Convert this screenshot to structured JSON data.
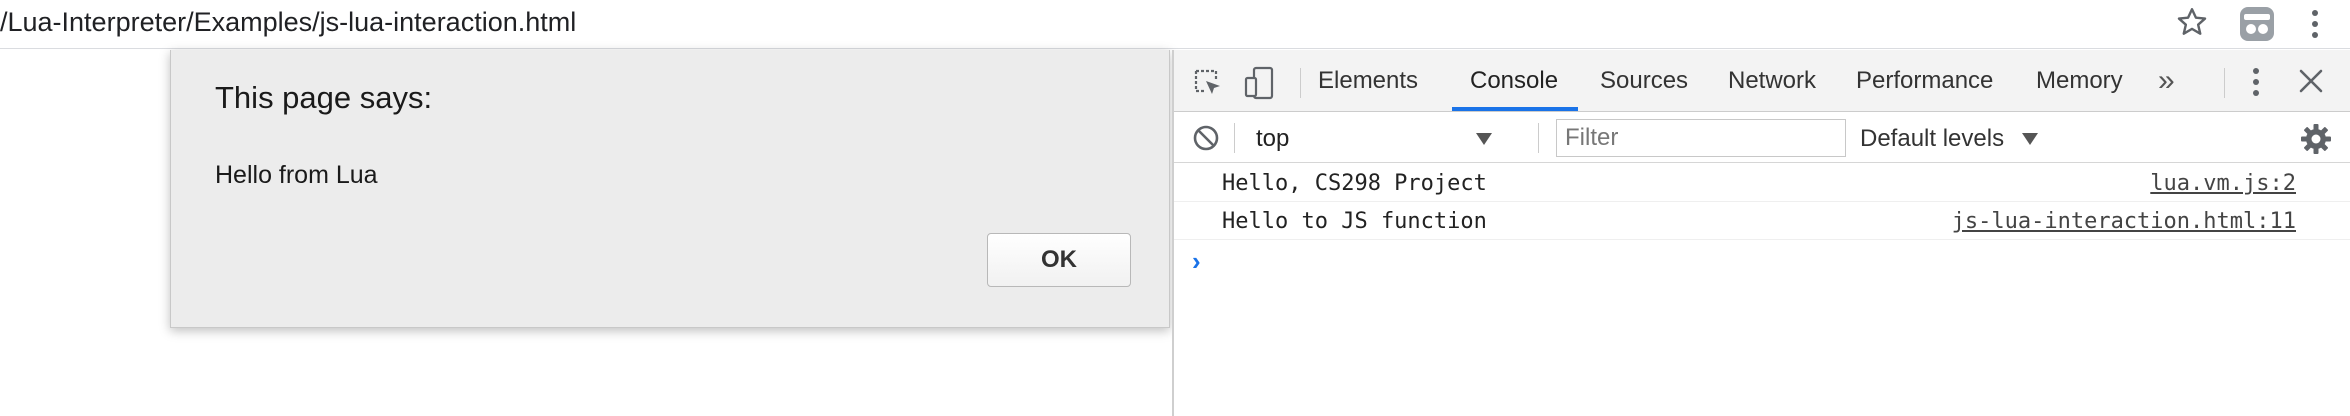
{
  "browser": {
    "url": "/Lua-Interpreter/Examples/js-lua-interaction.html",
    "icons": {
      "star": "star-icon",
      "profile": "incognito-icon",
      "menu": "kebab-menu-icon"
    }
  },
  "alert": {
    "title": "This page says:",
    "message": "Hello from Lua",
    "ok_label": "OK"
  },
  "devtools": {
    "tabs": [
      {
        "label": "Elements",
        "active": false
      },
      {
        "label": "Console",
        "active": true
      },
      {
        "label": "Sources",
        "active": false
      },
      {
        "label": "Network",
        "active": false
      },
      {
        "label": "Performance",
        "active": false
      },
      {
        "label": "Memory",
        "active": false
      }
    ],
    "more_tabs": "»",
    "accent": "#1a73e8",
    "toolbar": {
      "context": "top",
      "filter_placeholder": "Filter",
      "levels": "Default levels"
    },
    "console": {
      "messages": [
        {
          "text": "Hello, CS298 Project",
          "source": "lua.vm.js:2"
        },
        {
          "text": "Hello to JS function",
          "source": "js-lua-interaction.html:11"
        }
      ],
      "prompt": "›"
    }
  }
}
